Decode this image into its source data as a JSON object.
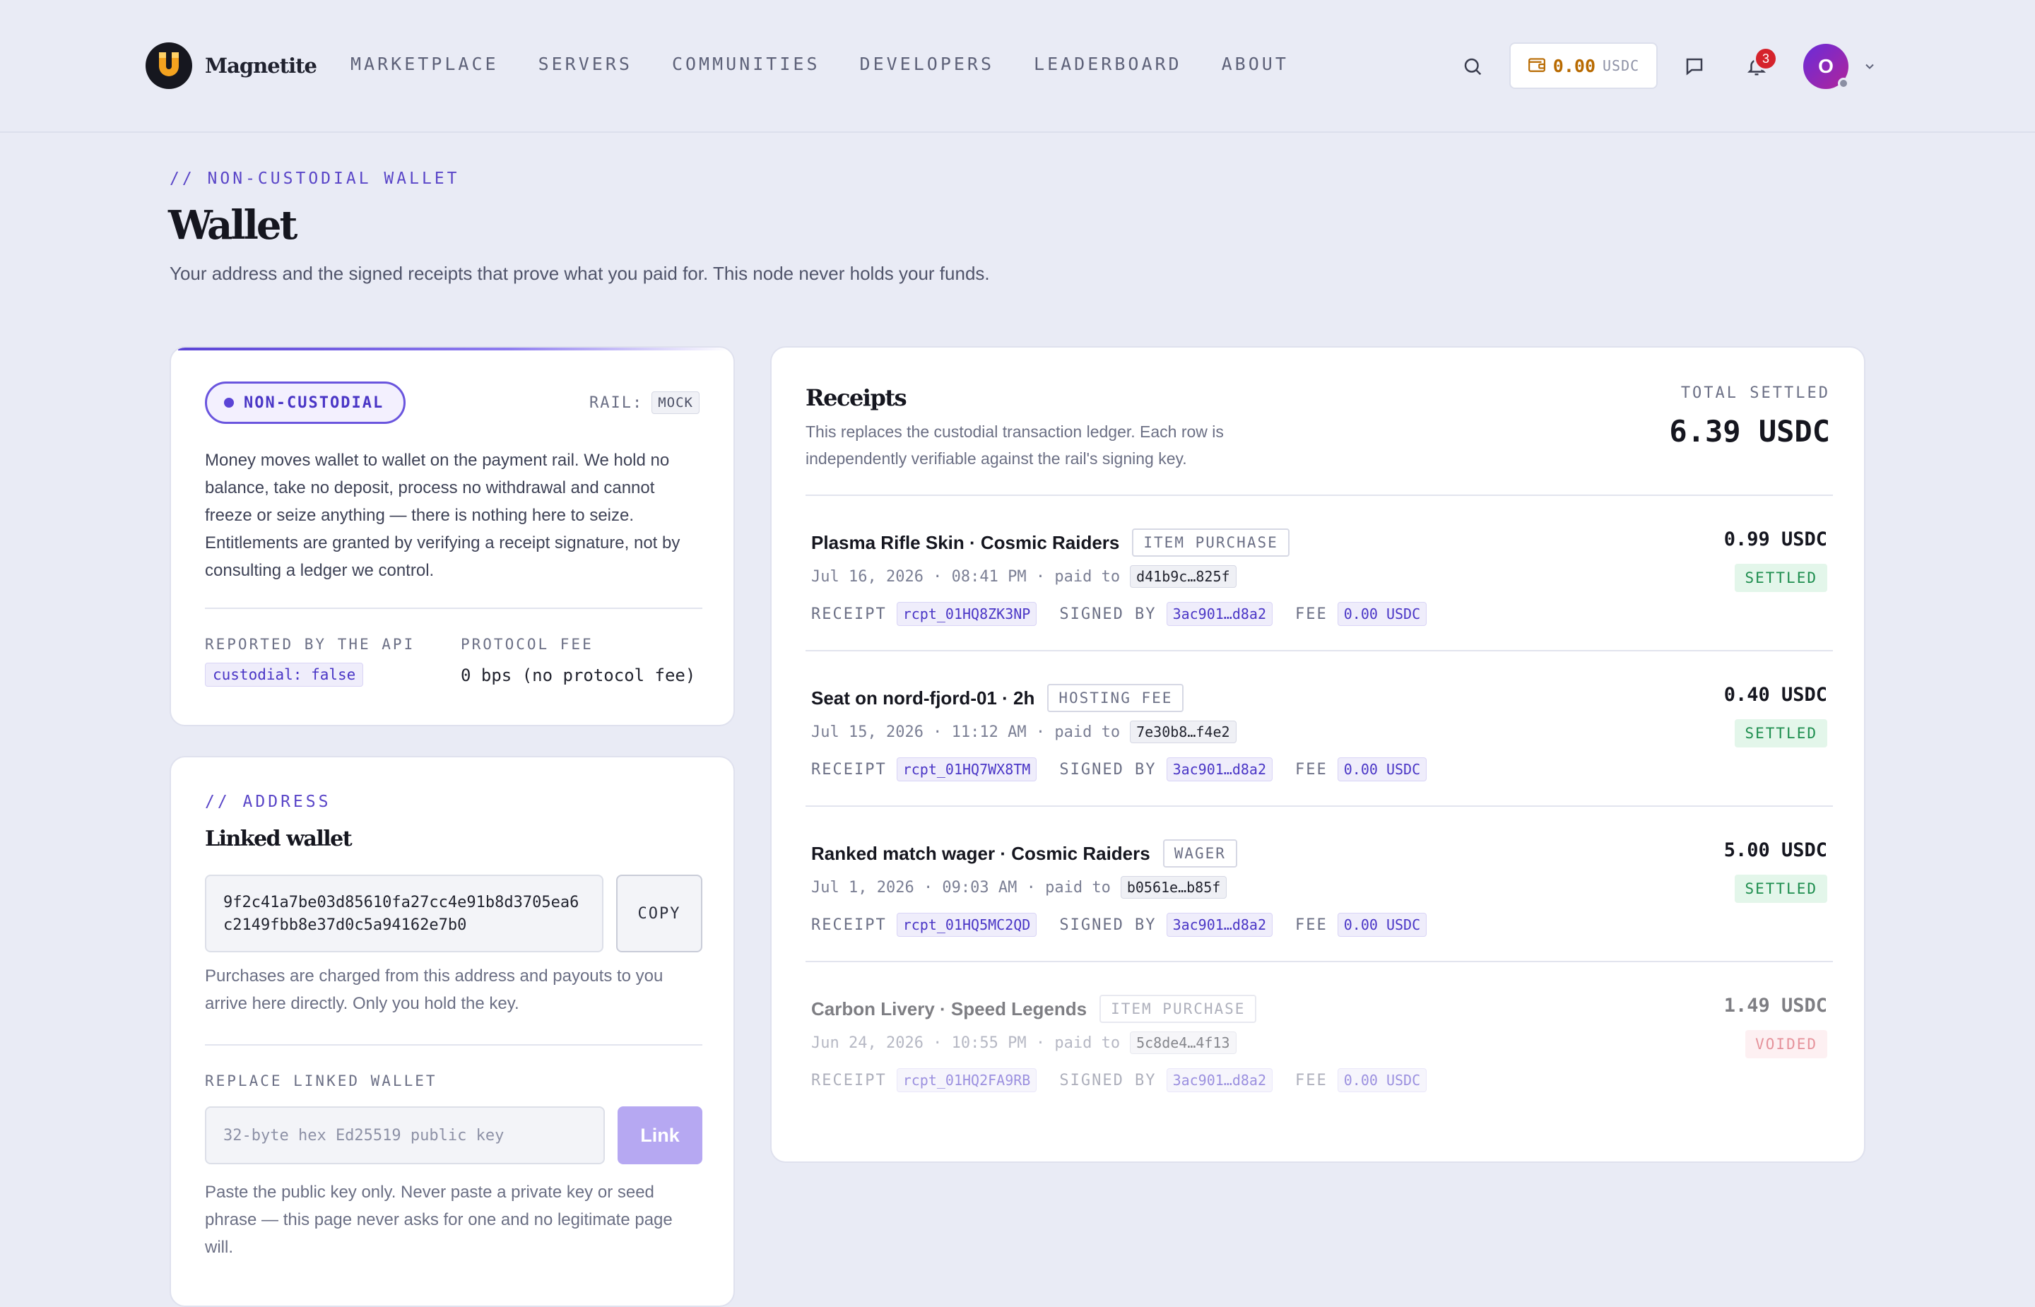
{
  "brand": {
    "name": "Magnetite"
  },
  "nav": {
    "items": [
      "MARKETPLACE",
      "SERVERS",
      "COMMUNITIES",
      "DEVELOPERS",
      "LEADERBOARD",
      "ABOUT"
    ]
  },
  "topbar": {
    "balance_amount": "0.00",
    "balance_currency": "USDC",
    "notification_count": "3",
    "avatar_initial": "O"
  },
  "page": {
    "eyebrow": "// NON-CUSTODIAL WALLET",
    "title": "Wallet",
    "subtitle": "Your address and the signed receipts that prove what you paid for. This node never holds your funds."
  },
  "status_card": {
    "pill_label": "NON-CUSTODIAL",
    "rail_label": "RAIL:",
    "rail_value": "MOCK",
    "body": "Money moves wallet to wallet on the payment rail. We hold no balance, take no deposit, process no withdrawal and cannot freeze or seize anything — there is nothing here to seize. Entitlements are granted by verifying a receipt signature, not by consulting a ledger we control.",
    "reported_label": "REPORTED BY THE API",
    "reported_value": "custodial: false",
    "fee_label": "PROTOCOL FEE",
    "fee_value": "0 bps (no protocol fee)"
  },
  "address_card": {
    "eyebrow": "// ADDRESS",
    "title": "Linked wallet",
    "address": "9f2c41a7be03d85610fa27cc4e91b8d3705ea6c2149fbb8e37d0c5a94162e7b0",
    "copy_label": "COPY",
    "address_help": "Purchases are charged from this address and payouts to you arrive here directly. Only you hold the key.",
    "replace_label": "REPLACE LINKED WALLET",
    "input_placeholder": "32-byte hex Ed25519 public key",
    "link_label": "Link",
    "warning": "Paste the public key only. Never paste a private key or seed phrase — this page never asks for one and no legitimate page will."
  },
  "receipts": {
    "title": "Receipts",
    "description": "This replaces the custodial transaction ledger. Each row is independently verifiable against the rail's signing key.",
    "total_label": "TOTAL SETTLED",
    "total_value": "6.39 USDC",
    "receipt_label": "RECEIPT",
    "signed_label": "SIGNED BY",
    "fee_label": "FEE",
    "rows": [
      {
        "name": "Plasma Rifle Skin · Cosmic Raiders",
        "kind": "ITEM PURCHASE",
        "date": "Jul 16, 2026 · 08:41 PM · paid to",
        "payee": "d41b9c…825f",
        "receipt": "rcpt_01HQ8ZK3NP",
        "signer": "3ac901…d8a2",
        "fee": "0.00 USDC",
        "amount": "0.99 USDC",
        "status": "SETTLED"
      },
      {
        "name": "Seat on nord-fjord-01 · 2h",
        "kind": "HOSTING FEE",
        "date": "Jul 15, 2026 · 11:12 AM · paid to",
        "payee": "7e30b8…f4e2",
        "receipt": "rcpt_01HQ7WX8TM",
        "signer": "3ac901…d8a2",
        "fee": "0.00 USDC",
        "amount": "0.40 USDC",
        "status": "SETTLED"
      },
      {
        "name": "Ranked match wager · Cosmic Raiders",
        "kind": "WAGER",
        "date": "Jul 1, 2026 · 09:03 AM · paid to",
        "payee": "b0561e…b85f",
        "receipt": "rcpt_01HQ5MC2QD",
        "signer": "3ac901…d8a2",
        "fee": "0.00 USDC",
        "amount": "5.00 USDC",
        "status": "SETTLED"
      },
      {
        "name": "Carbon Livery · Speed Legends",
        "kind": "ITEM PURCHASE",
        "date": "Jun 24, 2026 · 10:55 PM · paid to",
        "payee": "5c8de4…4f13",
        "receipt": "rcpt_01HQ2FA9RB",
        "signer": "3ac901…d8a2",
        "fee": "0.00 USDC",
        "amount": "1.49 USDC",
        "status": "VOIDED"
      }
    ]
  },
  "colors": {
    "accent": "#5b44d6",
    "balance": "#b86a00",
    "settled": "#1e8e4f",
    "voided": "#d03a4a",
    "background": "#e9ebf5"
  }
}
